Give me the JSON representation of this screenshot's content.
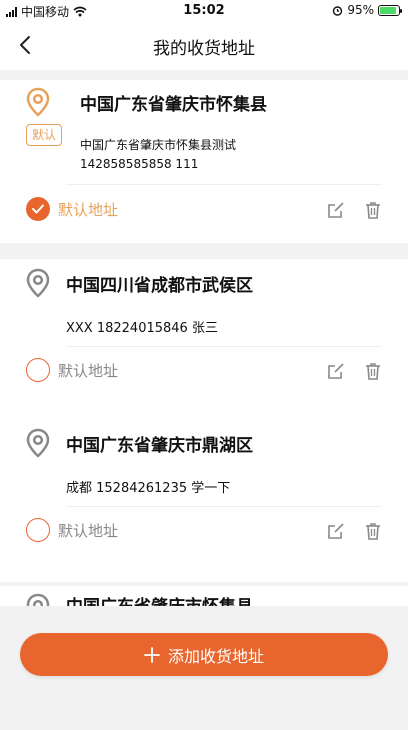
{
  "status_bar": {
    "carrier": "中国移动",
    "time": "15:02",
    "battery": "95%"
  },
  "nav": {
    "title": "我的收货地址"
  },
  "addresses": [
    {
      "region": "中国广东省肇庆市怀集县",
      "tag": "默认",
      "detail": "中国广东省肇庆市怀集县测试",
      "phone_line": "142858585858   111",
      "default_label": "默认地址",
      "is_default": true
    },
    {
      "region": "中国四川省成都市武侯区",
      "contact_line": "XXX   18224015846   张三",
      "default_label": "默认地址",
      "is_default": false
    },
    {
      "region": "中国广东省肇庆市鼎湖区",
      "contact_line": "成都   15284261235   学一下",
      "default_label": "默认地址",
      "is_default": false
    },
    {
      "region": "中国广东省肇庆市怀集县"
    }
  ],
  "add_button": {
    "label": "添加收货地址"
  },
  "colors": {
    "accent": "#e8662e",
    "default_text": "#e8a15a",
    "icon_gray": "#888888"
  }
}
